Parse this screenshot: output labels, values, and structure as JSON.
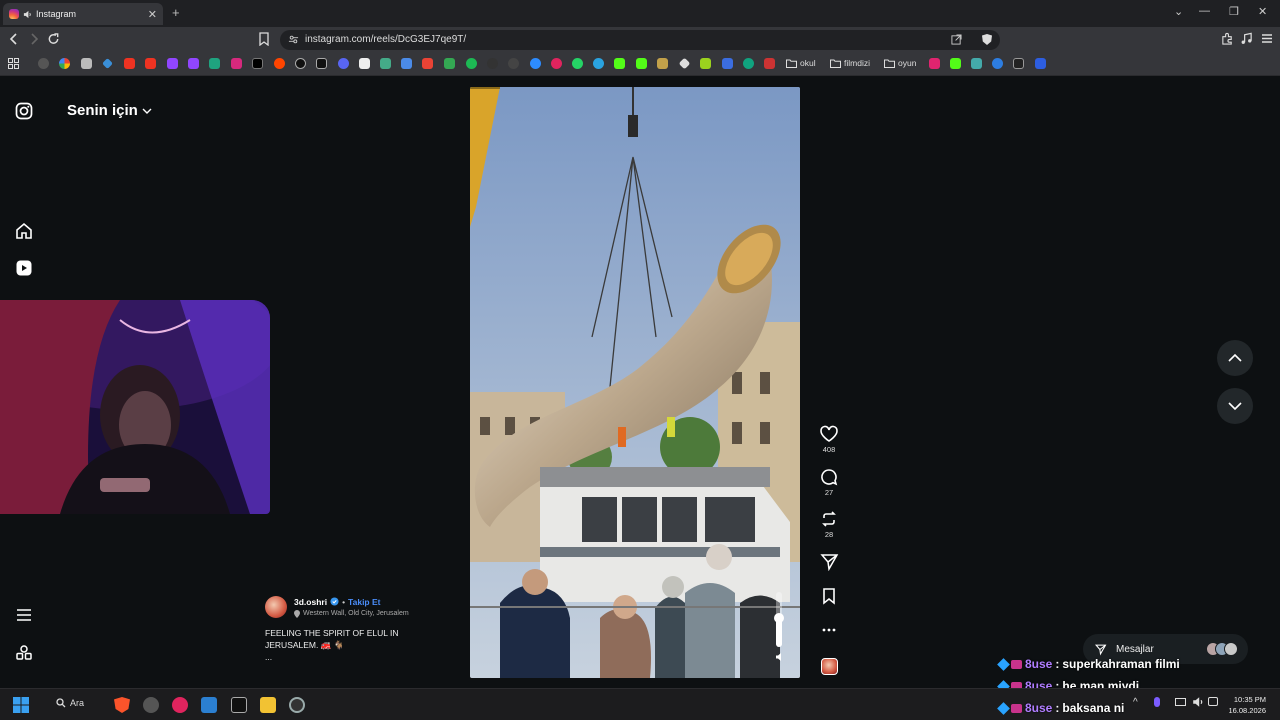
{
  "browser": {
    "tab_title": "Instagram",
    "url": "instagram.com/reels/DcG3EJ7qe9T/",
    "bookmark_folders": [
      "okul",
      "filmdizi",
      "oyun"
    ]
  },
  "instagram": {
    "section_title": "Senin için",
    "post": {
      "username": "3d.oshri",
      "separator": "•",
      "follow_label": "Takip Et",
      "location": "Western Wall, Old City, Jerusalem",
      "caption_line1": "FEELING THE SPIRIT OF ELUL IN",
      "caption_line2": "JERUSALEM. 🚒 🐐",
      "more": "..."
    },
    "actions": {
      "likes": "408",
      "comments": "27",
      "reposts": "28"
    },
    "messages_label": "Mesajlar"
  },
  "chat": [
    {
      "user": "8use",
      "sep": ":",
      "text": "superkahraman filmi"
    },
    {
      "user": "8use",
      "sep": ":",
      "text": "he man miydi"
    },
    {
      "user": "8use",
      "sep": ":",
      "text": "baksana ni"
    }
  ],
  "taskbar": {
    "search_label": "Ara",
    "time": "10:35 PM",
    "date": "16.08.2026"
  },
  "colors": {
    "accent_follow": "#4a8cf7",
    "chat_user": "#b07dff",
    "page_bg": "#0d1012"
  }
}
